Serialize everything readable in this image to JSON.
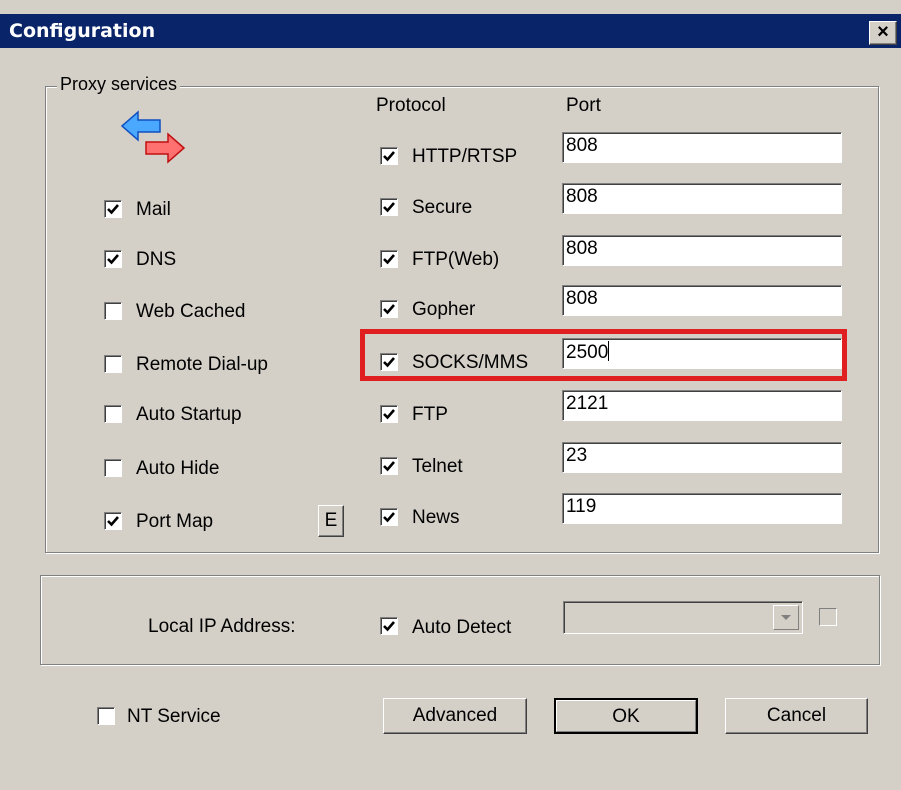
{
  "window": {
    "title": "Configuration",
    "close": "×"
  },
  "proxy_group": {
    "label": "Proxy services",
    "protocol_header": "Protocol",
    "port_header": "Port",
    "services": [
      {
        "label": "Mail",
        "checked": true
      },
      {
        "label": "DNS",
        "checked": true
      },
      {
        "label": "Web Cached",
        "checked": false
      },
      {
        "label": "Remote Dial-up",
        "checked": false
      },
      {
        "label": "Auto Startup",
        "checked": false
      },
      {
        "label": "Auto Hide",
        "checked": false
      },
      {
        "label": "Port Map",
        "checked": true
      }
    ],
    "port_map_edit": "E",
    "protocols": [
      {
        "label": "HTTP/RTSP",
        "checked": true,
        "port": "808"
      },
      {
        "label": "Secure",
        "checked": true,
        "port": "808"
      },
      {
        "label": "FTP(Web)",
        "checked": true,
        "port": "808"
      },
      {
        "label": "Gopher",
        "checked": true,
        "port": "808"
      },
      {
        "label": "SOCKS/MMS",
        "checked": true,
        "port": "2500"
      },
      {
        "label": "FTP",
        "checked": true,
        "port": "2121"
      },
      {
        "label": "Telnet",
        "checked": true,
        "port": "23"
      },
      {
        "label": "News",
        "checked": true,
        "port": "119"
      }
    ]
  },
  "local_ip": {
    "label": "Local IP Address:",
    "auto_detect_label": "Auto Detect",
    "auto_detect_checked": true,
    "address_value": ""
  },
  "footer": {
    "nt_service_label": "NT Service",
    "nt_service_checked": false,
    "advanced": "Advanced",
    "ok": "OK",
    "cancel": "Cancel"
  }
}
